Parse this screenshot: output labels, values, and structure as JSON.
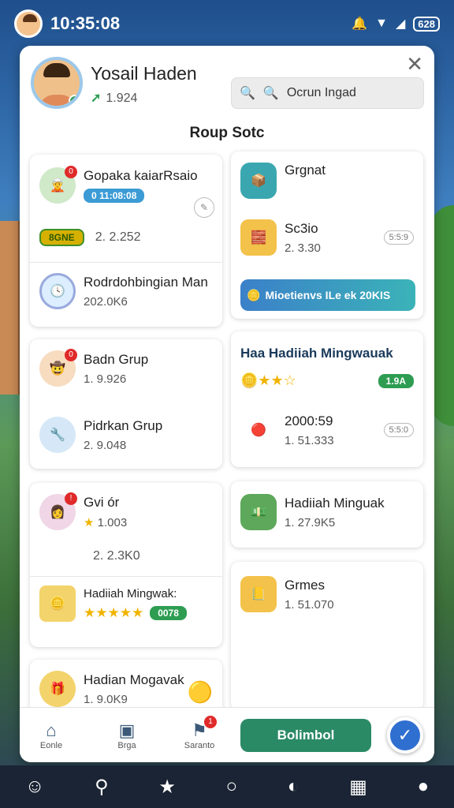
{
  "status": {
    "time": "10:35:08",
    "notif_count": "0",
    "battery": "628"
  },
  "profile": {
    "name": "Yosail Haden",
    "score": "1.924"
  },
  "search": {
    "placeholder": "Ocrun Ingad"
  },
  "section": {
    "title": "Roup Sotc"
  },
  "left_cards": [
    {
      "title": "Gopaka kaiarRsaio",
      "badge": "0 11:08:08",
      "sub_pill": "8GNE",
      "value": "2. 2.252"
    },
    {
      "title": "Rodrdohbingian Man",
      "value": "202.0K6"
    },
    {
      "title": "Badn Grup",
      "value": "1. 9.926"
    },
    {
      "title": "Pidrkan Grup",
      "value": "2. 9.048"
    },
    {
      "title": "Gvi ór",
      "rating_text": "1.003",
      "value": "2. 2.3K0"
    },
    {
      "title": "Hadiiah Mingwak:",
      "pill": "0078"
    },
    {
      "title": "Hadian Mogavak",
      "value": "1. 9.0K9"
    }
  ],
  "right_cards": [
    {
      "title": "Grgnat"
    },
    {
      "title": "Sc3io",
      "value": "2. 3.30",
      "outline": "5:5:9"
    },
    {
      "banner": "Mioetienvs ILe ek 20KIS"
    },
    {
      "title": "Haa Hadiiah Mingwauak",
      "pill": "1.9A"
    },
    {
      "title": "2000:59",
      "value": "1. 51.333",
      "outline": "5:5:0"
    },
    {
      "title": "Hadiiah Minguak",
      "value": "1. 27.9K5"
    },
    {
      "title": "Grmes",
      "value": "1. 51.070"
    }
  ],
  "nav": {
    "home": "Eonle",
    "bag": "Brga",
    "search": "Saranto",
    "primary": "Bolimbol",
    "badge": "1"
  },
  "colors": {
    "accent": "#2b8a66",
    "blue": "#2f6fd0",
    "red": "#e02a2a"
  }
}
